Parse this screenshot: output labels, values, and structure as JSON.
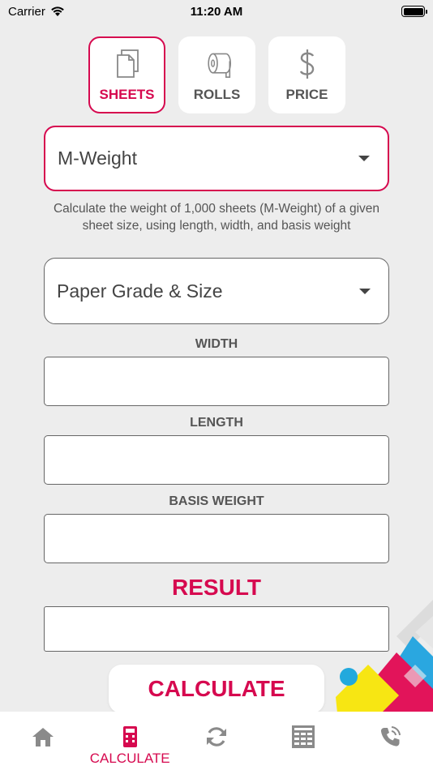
{
  "status": {
    "carrier": "Carrier",
    "time": "11:20 AM"
  },
  "tabs": [
    {
      "label": "SHEETS",
      "icon": "sheets-icon",
      "active": true
    },
    {
      "label": "ROLLS",
      "icon": "roll-icon",
      "active": false
    },
    {
      "label": "PRICE",
      "icon": "dollar-icon",
      "active": false
    }
  ],
  "calculator": {
    "selected": "M-Weight",
    "description": "Calculate the weight of 1,000 sheets (M-Weight) of a given sheet size, using length, width, and basis weight"
  },
  "grade_dropdown": {
    "placeholder": "Paper Grade & Size"
  },
  "fields": {
    "width_label": "WIDTH",
    "length_label": "LENGTH",
    "basis_weight_label": "BASIS WEIGHT",
    "result_label": "RESULT"
  },
  "actions": {
    "calculate": "CALCULATE"
  },
  "nav": [
    {
      "label": "",
      "icon": "home-icon"
    },
    {
      "label": "CALCULATE",
      "icon": "calculator-icon",
      "active": true
    },
    {
      "label": "",
      "icon": "refresh-icon"
    },
    {
      "label": "",
      "icon": "table-icon"
    },
    {
      "label": "",
      "icon": "phone-icon"
    }
  ],
  "colors": {
    "accent": "#d6094f",
    "background": "#ededed"
  }
}
